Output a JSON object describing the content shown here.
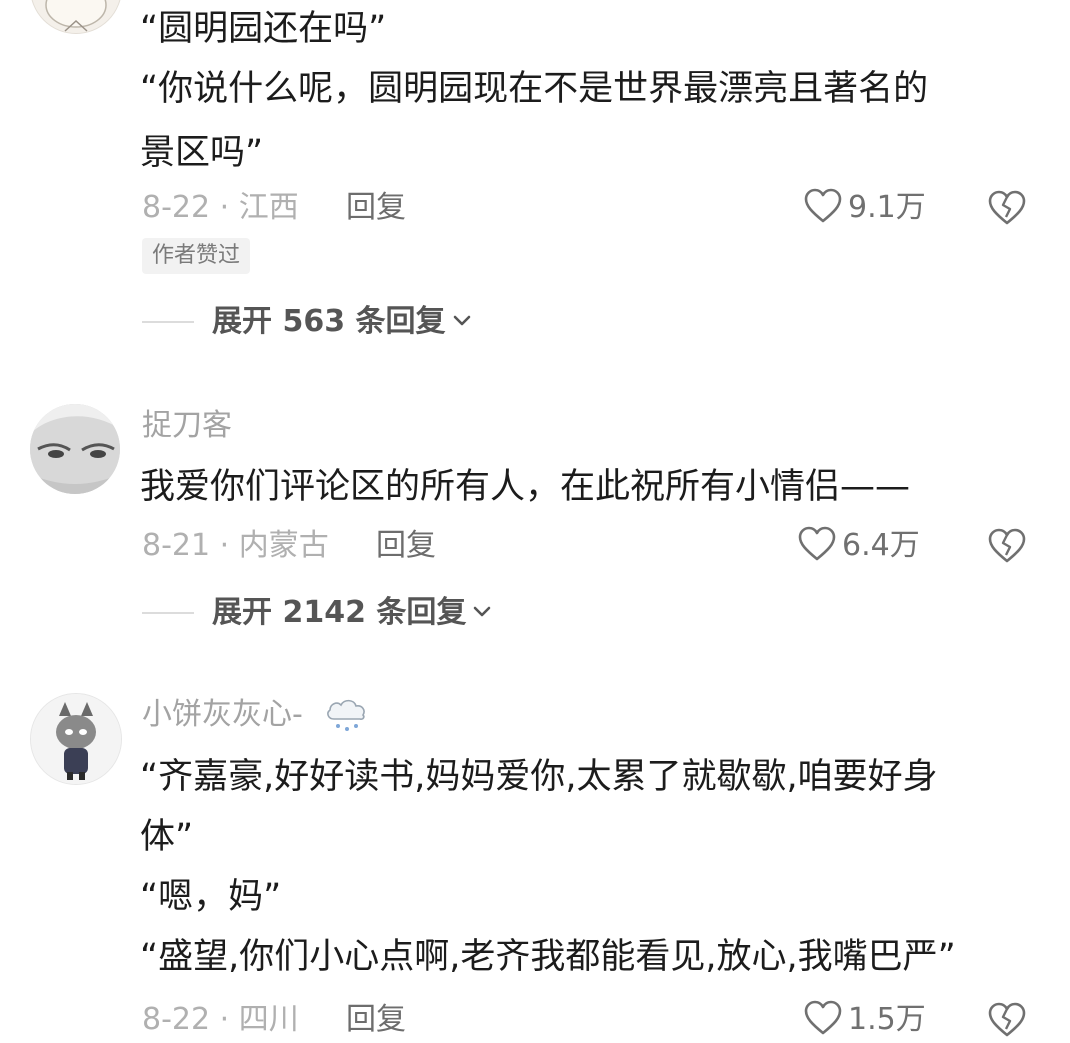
{
  "comments": [
    {
      "username": "",
      "lines": [
        "“圆明园还在吗”",
        "“你说什么呢，圆明园现在不是世界最漂亮且著名的",
        "景区吗”"
      ],
      "date_location": "8-22 · 江西",
      "reply_label": "回复",
      "likes": "9.1万",
      "badge": "作者赞过",
      "expand_label": "展开 563 条回复"
    },
    {
      "username": "捉刀客",
      "lines": [
        "我爱你们评论区的所有人，在此祝所有小情侣——"
      ],
      "date_location": "8-21 · 内蒙古",
      "reply_label": "回复",
      "likes": "6.4万",
      "expand_label": "展开 2142 条回复"
    },
    {
      "username": "小饼灰灰心-",
      "lines": [
        "“齐嘉豪,好好读书,妈妈爱你,太累了就歇歇,咱要好身",
        "体”",
        "“嗯，妈”",
        "“盛望,你们小心点啊,老齐我都能看见,放心,我嘴巴严”"
      ],
      "date_location": "8-22 · 四川",
      "reply_label": "回复",
      "likes": "1.5万"
    }
  ],
  "icons": {
    "like": "heart-outline-icon",
    "dislike": "broken-heart-icon",
    "expand": "chevron-down-icon",
    "weather": "snow-cloud-icon"
  }
}
